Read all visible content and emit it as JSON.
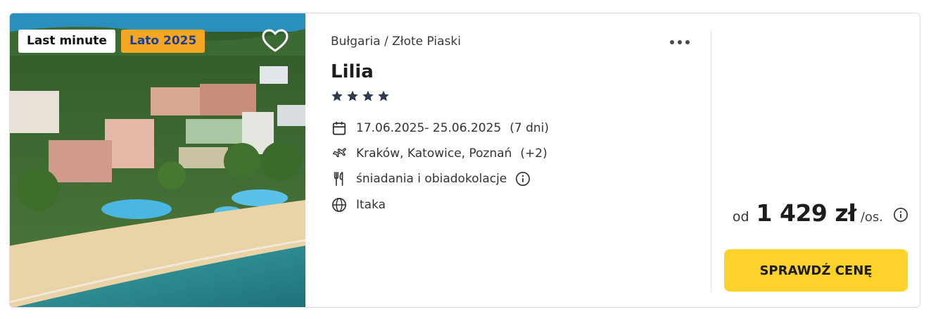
{
  "offer": {
    "badges": {
      "last_minute": "Last minute",
      "season": "Lato 2025"
    },
    "location": "Bułgaria / Złote Piaski",
    "hotel_name": "Lilia",
    "stars": 4,
    "dates": "17.06.2025- 25.06.2025",
    "duration": "(7 dni)",
    "airports": "Kraków, Katowice, Poznań",
    "airports_more": "(+2)",
    "board": "śniadania i obiadokolacje",
    "operator": "Itaka",
    "price": {
      "from_label": "od",
      "amount": "1 429 zł",
      "per_label": "/os."
    },
    "cta_label": "SPRAWDŹ CENĘ"
  },
  "icons": {
    "favorite": "heart-icon",
    "more": "more-dots-icon",
    "star": "star-icon",
    "calendar": "calendar-icon",
    "flight": "plane-icon",
    "board": "cutlery-icon",
    "info": "info-icon",
    "operator": "globe-icon"
  },
  "colors": {
    "badge_season_bg": "#f5a623",
    "badge_season_text": "#1d3f8f",
    "cta_bg": "#fdd22a",
    "star": "#2f3a4f"
  }
}
